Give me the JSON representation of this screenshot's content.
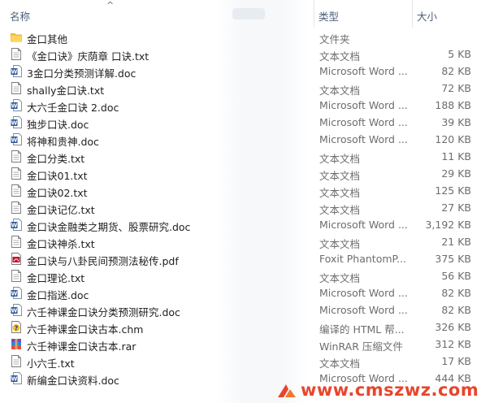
{
  "header": {
    "name": "名称",
    "type": "类型",
    "size": "大小",
    "sort_arrow": "^"
  },
  "files": [
    {
      "name": "金口其他",
      "type": "文件夹",
      "size": "",
      "icon": "folder-icon"
    },
    {
      "name": "《金口诀》庆荫章 口诀.txt",
      "type": "文本文档",
      "size": "5 KB",
      "icon": "text-file-icon"
    },
    {
      "name": "3金口分类预测详解.doc",
      "type": "Microsoft Word ...",
      "size": "82 KB",
      "icon": "word-doc-icon"
    },
    {
      "name": "shally金口诀.txt",
      "type": "文本文档",
      "size": "72 KB",
      "icon": "text-file-icon"
    },
    {
      "name": "大六壬金口诀 2.doc",
      "type": "Microsoft Word ...",
      "size": "188 KB",
      "icon": "word-doc-icon"
    },
    {
      "name": "独步口诀.doc",
      "type": "Microsoft Word ...",
      "size": "39 KB",
      "icon": "word-doc-icon"
    },
    {
      "name": "将神和贵神.doc",
      "type": "Microsoft Word ...",
      "size": "120 KB",
      "icon": "word-doc-icon"
    },
    {
      "name": "金口分类.txt",
      "type": "文本文档",
      "size": "11 KB",
      "icon": "text-file-icon"
    },
    {
      "name": "金口诀01.txt",
      "type": "文本文档",
      "size": "29 KB",
      "icon": "text-file-icon"
    },
    {
      "name": "金口诀02.txt",
      "type": "文本文档",
      "size": "125 KB",
      "icon": "text-file-icon"
    },
    {
      "name": "金口诀记亿.txt",
      "type": "文本文档",
      "size": "27 KB",
      "icon": "text-file-icon"
    },
    {
      "name": "金口诀金融类之期货、股票研究.doc",
      "type": "Microsoft Word ...",
      "size": "3,192 KB",
      "icon": "word-doc-icon"
    },
    {
      "name": "金口诀神杀.txt",
      "type": "文本文档",
      "size": "21 KB",
      "icon": "text-file-icon"
    },
    {
      "name": "金口诀与八卦民间预测法秘传.pdf",
      "type": "Foxit PhantomP...",
      "size": "375 KB",
      "icon": "pdf-file-icon"
    },
    {
      "name": "金口理论.txt",
      "type": "文本文档",
      "size": "56 KB",
      "icon": "text-file-icon"
    },
    {
      "name": "金口指迷.doc",
      "type": "Microsoft Word ...",
      "size": "82 KB",
      "icon": "word-doc-icon"
    },
    {
      "name": "六壬神课金口诀分类预测研究.doc",
      "type": "Microsoft Word ...",
      "size": "82 KB",
      "icon": "word-doc-icon"
    },
    {
      "name": "六壬神课金口诀古本.chm",
      "type": "编译的 HTML 帮...",
      "size": "326 KB",
      "icon": "chm-help-icon"
    },
    {
      "name": "六壬神课金口诀古本.rar",
      "type": "WinRAR 压缩文件",
      "size": "312 KB",
      "icon": "rar-archive-icon"
    },
    {
      "name": "小六壬.txt",
      "type": "文本文档",
      "size": "17 KB",
      "icon": "text-file-icon"
    },
    {
      "name": "新编金口诀资料.doc",
      "type": "Microsoft Word ...",
      "size": "444 KB",
      "icon": "word-doc-icon"
    }
  ],
  "watermark": {
    "text": "www.cmszwz.com",
    "color": "#e8452d"
  },
  "colors": {
    "header_text": "#4c607a",
    "secondary_text": "#6d6d6d",
    "folder": "#f5c342",
    "word_blue": "#2b579a"
  }
}
